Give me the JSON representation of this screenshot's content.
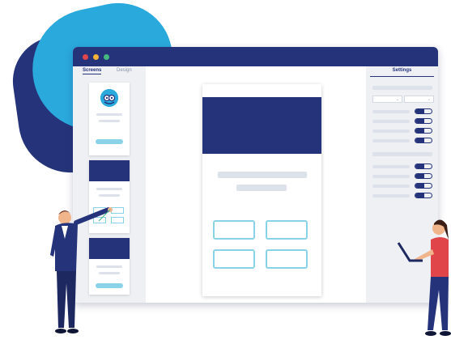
{
  "colors": {
    "navy": "#25337a",
    "cyan": "#2aa9dd",
    "light_cyan": "#8ad2e8",
    "panel": "#eef0f4",
    "red": "#e0454a",
    "orange": "#f4b338",
    "green": "#43b97f"
  },
  "window": {
    "traffic_lights": [
      "close",
      "minimize",
      "maximize"
    ]
  },
  "left_panel": {
    "tabs": [
      {
        "label": "Screens",
        "active": true
      },
      {
        "label": "Design",
        "active": false
      }
    ],
    "screen_count": 3
  },
  "settings": {
    "title": "Settings",
    "toggles_group1": [
      true,
      true,
      true,
      true
    ],
    "toggles_group2": [
      true,
      true,
      true,
      true
    ]
  },
  "canvas": {
    "card_boxes": 4
  },
  "illustration": {
    "people": [
      "man-pointing",
      "woman-with-laptop"
    ]
  }
}
